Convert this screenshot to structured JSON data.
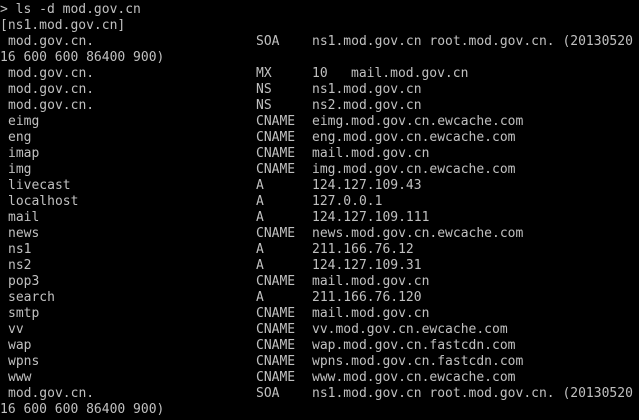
{
  "terminal": {
    "command_line": "> ls -d mod.gov.cn",
    "server_line": "[ns1.mod.gov.cn]",
    "soa_top": {
      "name": "mod.gov.cn.",
      "type": "SOA",
      "data": "ns1.mod.gov.cn root.mod.gov.cn. (20130520",
      "continuation": "16 600 600 86400 900)"
    },
    "mx": {
      "name": "mod.gov.cn.",
      "type": "MX",
      "preference": "10",
      "data": "mail.mod.gov.cn"
    },
    "records": [
      {
        "name": "mod.gov.cn.",
        "type": "NS",
        "data": "ns1.mod.gov.cn"
      },
      {
        "name": "mod.gov.cn.",
        "type": "NS",
        "data": "ns2.mod.gov.cn"
      },
      {
        "name": "eimg",
        "type": "CNAME",
        "data": "eimg.mod.gov.cn.ewcache.com"
      },
      {
        "name": "eng",
        "type": "CNAME",
        "data": "eng.mod.gov.cn.ewcache.com"
      },
      {
        "name": "imap",
        "type": "CNAME",
        "data": "mail.mod.gov.cn"
      },
      {
        "name": "img",
        "type": "CNAME",
        "data": "img.mod.gov.cn.ewcache.com"
      },
      {
        "name": "livecast",
        "type": "A",
        "data": "124.127.109.43"
      },
      {
        "name": "localhost",
        "type": "A",
        "data": "127.0.0.1"
      },
      {
        "name": "mail",
        "type": "A",
        "data": "124.127.109.111"
      },
      {
        "name": "news",
        "type": "CNAME",
        "data": "news.mod.gov.cn.ewcache.com"
      },
      {
        "name": "ns1",
        "type": "A",
        "data": "211.166.76.12"
      },
      {
        "name": "ns2",
        "type": "A",
        "data": "124.127.109.31"
      },
      {
        "name": "pop3",
        "type": "CNAME",
        "data": "mail.mod.gov.cn"
      },
      {
        "name": "search",
        "type": "A",
        "data": "211.166.76.120"
      },
      {
        "name": "smtp",
        "type": "CNAME",
        "data": "mail.mod.gov.cn"
      },
      {
        "name": "vv",
        "type": "CNAME",
        "data": "vv.mod.gov.cn.ewcache.com"
      },
      {
        "name": "wap",
        "type": "CNAME",
        "data": "wap.mod.gov.cn.fastcdn.com"
      },
      {
        "name": "wpns",
        "type": "CNAME",
        "data": "wpns.mod.gov.cn.fastcdn.com"
      },
      {
        "name": "www",
        "type": "CNAME",
        "data": "www.mod.gov.cn.ewcache.com"
      }
    ],
    "soa_bottom": {
      "name": "mod.gov.cn.",
      "type": "SOA",
      "data": "ns1.mod.gov.cn root.mod.gov.cn. (20130520",
      "continuation": "16 600 600 86400 900)"
    },
    "colors": {
      "background": "#000000",
      "foreground": "#c0c0c0"
    }
  }
}
